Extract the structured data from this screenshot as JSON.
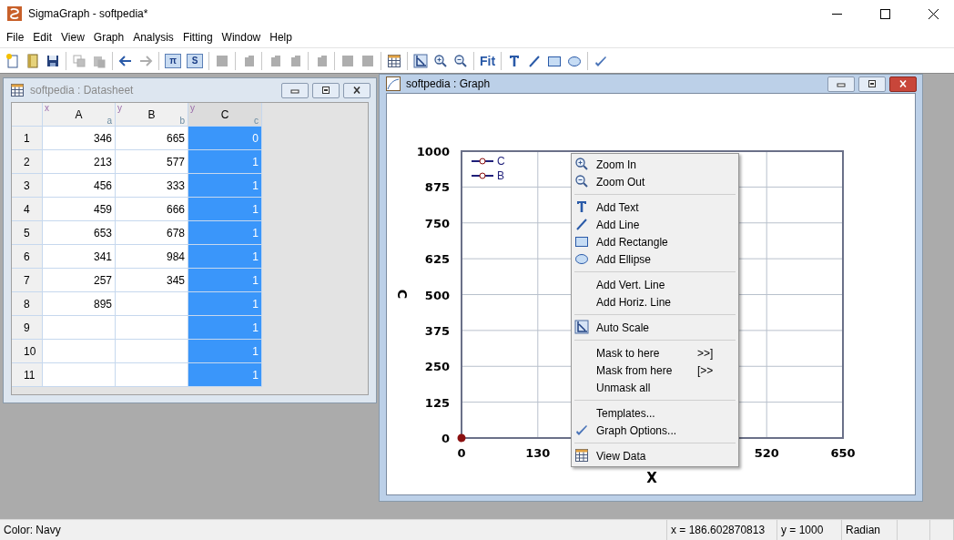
{
  "window": {
    "title": "SigmaGraph - softpedia*"
  },
  "menu_bar": [
    "File",
    "Edit",
    "View",
    "Graph",
    "Analysis",
    "Fitting",
    "Window",
    "Help"
  ],
  "toolbar": [
    {
      "kind": "button",
      "disabled": false
    },
    {
      "kind": "button",
      "disabled": false
    },
    {
      "kind": "button",
      "disabled": false
    },
    {
      "kind": "separator"
    },
    {
      "kind": "button",
      "disabled": true
    },
    {
      "kind": "button",
      "disabled": true
    },
    {
      "kind": "separator"
    },
    {
      "kind": "button",
      "disabled": false
    },
    {
      "kind": "button",
      "disabled": true
    },
    {
      "kind": "separator"
    },
    {
      "kind": "boxed-text",
      "text": "π",
      "disabled": false
    },
    {
      "kind": "boxed-text",
      "text": "S",
      "disabled": false
    },
    {
      "kind": "separator"
    },
    {
      "kind": "button",
      "disabled": true
    },
    {
      "kind": "separator"
    },
    {
      "kind": "button",
      "disabled": true
    },
    {
      "kind": "separator"
    },
    {
      "kind": "button",
      "disabled": true
    },
    {
      "kind": "button",
      "disabled": true
    },
    {
      "kind": "separator"
    },
    {
      "kind": "button",
      "disabled": true
    },
    {
      "kind": "separator"
    },
    {
      "kind": "button",
      "disabled": true
    },
    {
      "kind": "button",
      "disabled": true
    },
    {
      "kind": "separator"
    },
    {
      "kind": "button",
      "disabled": false
    },
    {
      "kind": "separator"
    },
    {
      "kind": "button",
      "disabled": false
    },
    {
      "kind": "button",
      "disabled": false
    },
    {
      "kind": "button",
      "disabled": false
    },
    {
      "kind": "separator"
    },
    {
      "kind": "plain-text",
      "text": "Fit",
      "disabled": false
    },
    {
      "kind": "separator"
    },
    {
      "kind": "button",
      "disabled": false
    },
    {
      "kind": "button",
      "disabled": false
    },
    {
      "kind": "button",
      "disabled": false
    },
    {
      "kind": "button",
      "disabled": false
    },
    {
      "kind": "separator"
    },
    {
      "kind": "button",
      "disabled": false
    }
  ],
  "datasheet": {
    "title": "softpedia : Datasheet",
    "active": false,
    "columns": [
      {
        "role": "x",
        "name": "A",
        "label": "a",
        "selected": false
      },
      {
        "role": "y",
        "name": "B",
        "label": "b",
        "selected": false
      },
      {
        "role": "y",
        "name": "C",
        "label": "c",
        "selected": true
      }
    ],
    "rows": [
      {
        "number": "1",
        "cells": [
          "346",
          "665",
          "0"
        ]
      },
      {
        "number": "2",
        "cells": [
          "213",
          "577",
          "1"
        ]
      },
      {
        "number": "3",
        "cells": [
          "456",
          "333",
          "1"
        ]
      },
      {
        "number": "4",
        "cells": [
          "459",
          "666",
          "1"
        ]
      },
      {
        "number": "5",
        "cells": [
          "653",
          "678",
          "1"
        ]
      },
      {
        "number": "6",
        "cells": [
          "341",
          "984",
          "1"
        ]
      },
      {
        "number": "7",
        "cells": [
          "257",
          "345",
          "1"
        ]
      },
      {
        "number": "8",
        "cells": [
          "895",
          "",
          "1"
        ]
      },
      {
        "number": "9",
        "cells": [
          "",
          "",
          "1"
        ]
      },
      {
        "number": "10",
        "cells": [
          "",
          "",
          "1"
        ]
      },
      {
        "number": "11",
        "cells": [
          "",
          "",
          "1"
        ]
      }
    ]
  },
  "graph": {
    "title": "softpedia : Graph",
    "active": true,
    "chart_data": {
      "type": "scatter",
      "xlabel": "X",
      "ylabel": "C",
      "grid": true,
      "x": [
        0
      ],
      "series": [
        {
          "name": "C",
          "color": "#8b1010",
          "values": [
            0
          ]
        },
        {
          "name": "B",
          "color": "#8b1010",
          "values": [
            null
          ]
        }
      ],
      "xlim": [
        0,
        650
      ],
      "ylim": [
        0,
        1000
      ],
      "xticks": [
        0,
        130,
        520,
        650
      ],
      "yticks": [
        0,
        125,
        250,
        375,
        500,
        625,
        750,
        875,
        1000
      ]
    }
  },
  "context_menu": [
    {
      "kind": "item",
      "label": "Zoom In"
    },
    {
      "kind": "item",
      "label": "Zoom Out"
    },
    {
      "kind": "separator"
    },
    {
      "kind": "item",
      "label": "Add Text"
    },
    {
      "kind": "item",
      "label": "Add Line"
    },
    {
      "kind": "item",
      "label": "Add Rectangle"
    },
    {
      "kind": "item",
      "label": "Add Ellipse"
    },
    {
      "kind": "separator"
    },
    {
      "kind": "item",
      "label": "Add Vert. Line"
    },
    {
      "kind": "item",
      "label": "Add Horiz. Line"
    },
    {
      "kind": "separator"
    },
    {
      "kind": "item",
      "label": "Auto Scale"
    },
    {
      "kind": "separator"
    },
    {
      "kind": "item",
      "label": "Mask to here",
      "shortcut": ">>]"
    },
    {
      "kind": "item",
      "label": "Mask from here",
      "shortcut": "[>>"
    },
    {
      "kind": "item",
      "label": "Unmask all"
    },
    {
      "kind": "separator"
    },
    {
      "kind": "item",
      "label": "Templates..."
    },
    {
      "kind": "item",
      "label": "Graph Options..."
    },
    {
      "kind": "separator"
    },
    {
      "kind": "item",
      "label": "View Data"
    }
  ],
  "status_bar": [
    "Color: Navy",
    "x = 186.602870813",
    "y = 1000",
    "Radian"
  ]
}
